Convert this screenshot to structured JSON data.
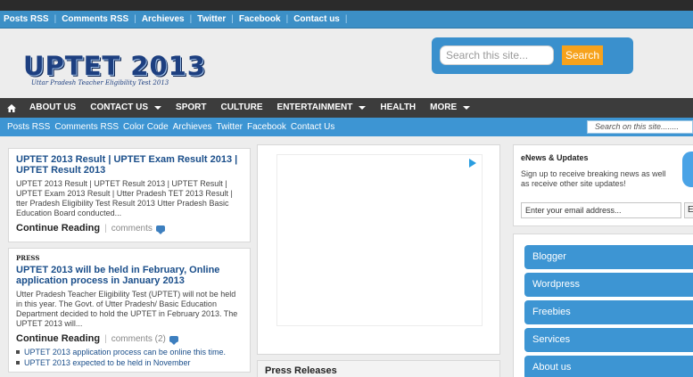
{
  "topbar": {
    "links": [
      "Posts RSS",
      "Comments RSS",
      "Archieves",
      "Twitter",
      "Facebook",
      "Contact us"
    ]
  },
  "header": {
    "logo": "UPTET 2013",
    "tagline": "Uttar Pradesh Teacher Eligibility Test 2013",
    "search_placeholder": "Search this site...",
    "search_button": "Search"
  },
  "mainnav": {
    "items": [
      {
        "label": "ABOUT US",
        "dropdown": false
      },
      {
        "label": "CONTACT US",
        "dropdown": true
      },
      {
        "label": "SPORT",
        "dropdown": false
      },
      {
        "label": "CULTURE",
        "dropdown": false
      },
      {
        "label": "ENTERTAINMENT",
        "dropdown": true
      },
      {
        "label": "HEALTH",
        "dropdown": false
      },
      {
        "label": "MORE",
        "dropdown": true
      }
    ]
  },
  "subnav": {
    "links": [
      "Posts RSS",
      "Comments RSS",
      "Color Code",
      "Archieves",
      "Twitter",
      "Facebook",
      "Contact Us"
    ],
    "search_placeholder": "Search on this site........"
  },
  "posts": [
    {
      "title": "UPTET 2013 Result | UPTET Exam Result 2013 | UPTET Result 2013",
      "excerpt": "UPTET 2013 Result | UPTET Result 2013 | UPTET Result | UPTET Exam 2013 Result | Utter Pradesh TET 2013 Result | tter Pradesh Eligibility Test Result 2013 Utter Pradesh Basic Education Board conducted...",
      "continue": "Continue Reading",
      "comments": "comments"
    },
    {
      "label": "PRESS",
      "title": "UPTET 2013 will be held in February, Online application process in January 2013",
      "excerpt": "Utter Pradesh Teacher Eligibility Test (UPTET) will not be held in this year. The Govt. of Utter Pradesh/ Basic Education Department decided to hold the UPTET in February 2013. The UPTET 2013 will...",
      "continue": "Continue Reading",
      "comments": "comments (2)",
      "related": [
        "UPTET 2013 application process can be online this time.",
        "UPTET 2013 expected to be held in November"
      ]
    }
  ],
  "press": {
    "title": "Press Releases"
  },
  "enews": {
    "title": "eNews & Updates",
    "text": "Sign up to receive breaking news as well as receive other site updates!",
    "email_placeholder": "Enter your email address...",
    "button": "E"
  },
  "categories": [
    "Blogger",
    "Wordpress",
    "Freebies",
    "Services",
    "About us"
  ],
  "colors": {
    "topbar": "#3c8fc6",
    "mainnav": "#3c3c3c",
    "subnav": "#3d95d3",
    "accent_orange": "#f6a21c",
    "link_blue": "#1a4e8a"
  }
}
